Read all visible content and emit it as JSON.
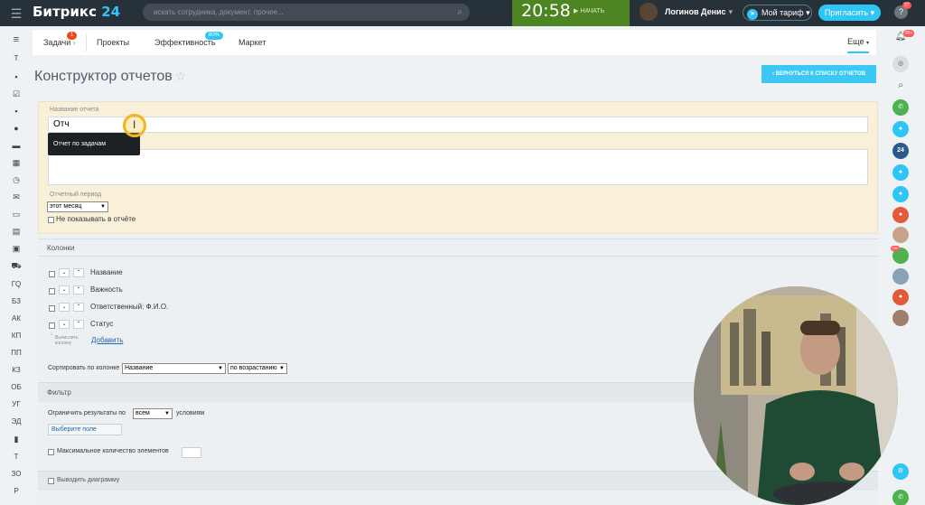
{
  "topbar": {
    "brand_name": "Битрикс",
    "brand_number": "24",
    "search_placeholder": "искать сотрудника, документ, прочее...",
    "clock_time": "20:58",
    "clock_action": "НАЧАТЬ",
    "user_name": "Логинов Денис",
    "plan_label": "Мой тариф",
    "invite_label": "Пригласить",
    "help_badge": "37"
  },
  "tabs": {
    "items": [
      {
        "label": "Задачи",
        "badge": "1"
      },
      {
        "label": "Проекты"
      },
      {
        "label": "Эффективность",
        "badge": "80%"
      },
      {
        "label": "Маркет"
      }
    ],
    "more_label": "Еще"
  },
  "page": {
    "title": "Конструктор отчетов",
    "back_button": "ВЕРНУТЬСЯ К СПИСКУ ОТЧЕТОВ"
  },
  "form": {
    "name_label": "Название отчета",
    "name_value": "Отч",
    "autocomplete_item": "Отчет по задачам",
    "period_label": "Отчетный период",
    "period_value": "этот месяц",
    "hide_period_label": "Не показывать в отчёте"
  },
  "columns": {
    "header": "Колонки",
    "items": [
      "Название",
      "Важность",
      "Ответственный: Ф.И.О.",
      "Статус"
    ],
    "calc_hint_line1": "Вычислить",
    "calc_hint_line2": "колонку",
    "add_link": "Добавить"
  },
  "sort": {
    "label": "Сортировать по колонке",
    "column_value": "Название",
    "order_value": "по возрастанию"
  },
  "filter": {
    "header": "Фильтр",
    "limit_prefix": "Ограничить результаты по",
    "limit_value": "всем",
    "limit_suffix": "условиям",
    "choose_field": "Выберите поле",
    "max_items_label": "Максимальное количество элементов"
  },
  "chart": {
    "header": "Выводить диаграмму"
  },
  "leftbar": {
    "items": [
      "T",
      "ГQ",
      "БЗ",
      "АК",
      "КП",
      "ПП",
      "КЗ",
      "ОБ",
      "УГ",
      "ЭД",
      "Т",
      "ЗО",
      "Р"
    ]
  },
  "rightbar": {
    "notification_badge": "99+",
    "chat_24": "24",
    "recent_badge": "TBK"
  },
  "colors": {
    "accent": "#2fc6f6",
    "topbar": "#27313a",
    "clock_bg": "#4c8521",
    "form_bg": "#f8f0d9"
  }
}
